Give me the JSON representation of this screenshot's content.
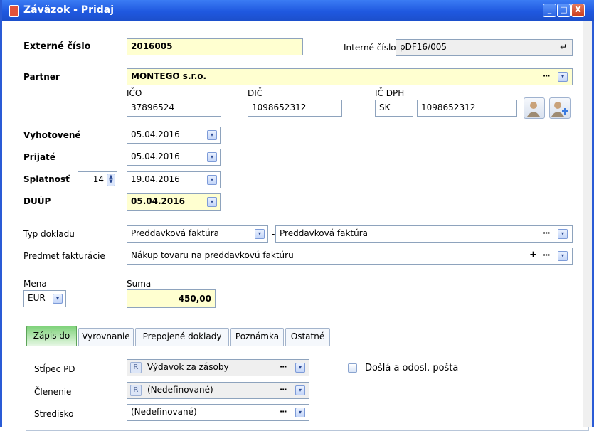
{
  "window": {
    "title": "Záväzok - Pridaj",
    "min_label": "_",
    "max_label": "□",
    "close_label": "X"
  },
  "externe_cislo": {
    "label": "Externé číslo",
    "value": "2016005"
  },
  "interne_cislo": {
    "label": "Interné číslo",
    "value": "pDF16/005",
    "action_icon": "↵"
  },
  "partner": {
    "label": "Partner",
    "value": "MONTEGO s.r.o.",
    "dots": "···"
  },
  "ico": {
    "label": "IČO",
    "value": "37896524"
  },
  "dic": {
    "label": "DIČ",
    "value": "1098652312"
  },
  "ic_dph": {
    "label": "IČ DPH",
    "prefix": "SK",
    "value": "1098652312"
  },
  "vyhotovene": {
    "label": "Vyhotovené",
    "value": "05.04.2016"
  },
  "prijate": {
    "label": "Prijaté",
    "value": "05.04.2016"
  },
  "splatnost": {
    "label": "Splatnosť",
    "days": "14",
    "value": "19.04.2016"
  },
  "duup": {
    "label": "DUÚP",
    "value": "05.04.2016"
  },
  "typ_dokladu": {
    "label": "Typ dokladu",
    "value": "Preddavková faktúra",
    "separator": "-",
    "value2": "Preddavková faktúra",
    "dots": "···"
  },
  "predmet": {
    "label": "Predmet fakturácie",
    "value": "Nákup tovaru na preddavkovú faktúru",
    "plus": "+",
    "dots": "···"
  },
  "mena": {
    "label": "Mena",
    "value": "EUR"
  },
  "suma": {
    "label": "Suma",
    "value": "450,00"
  },
  "tabs": [
    {
      "label": "Zápis do"
    },
    {
      "label": "Vyrovnanie"
    },
    {
      "label": "Prepojené doklady"
    },
    {
      "label": "Poznámka"
    },
    {
      "label": "Ostatné"
    }
  ],
  "zapis": {
    "stlpec_pd": {
      "label": "Stĺpec PD",
      "badge": "R",
      "value": "Výdavok za zásoby",
      "dots": "···"
    },
    "clenenie": {
      "label": "Členenie",
      "badge": "R",
      "value": "(Nedefinované)",
      "dots": "···"
    },
    "stredisko": {
      "label": "Stredisko",
      "value": "(Nedefinované)",
      "dots": "···"
    },
    "dosla": {
      "label": "Došlá a odosl. pošta",
      "checked": false
    }
  },
  "dropdown_glyph": "▾",
  "colors": {
    "titlebar": "#2a5bd6",
    "required_field": "#ffffd0",
    "active_tab": "#7fd27a"
  }
}
